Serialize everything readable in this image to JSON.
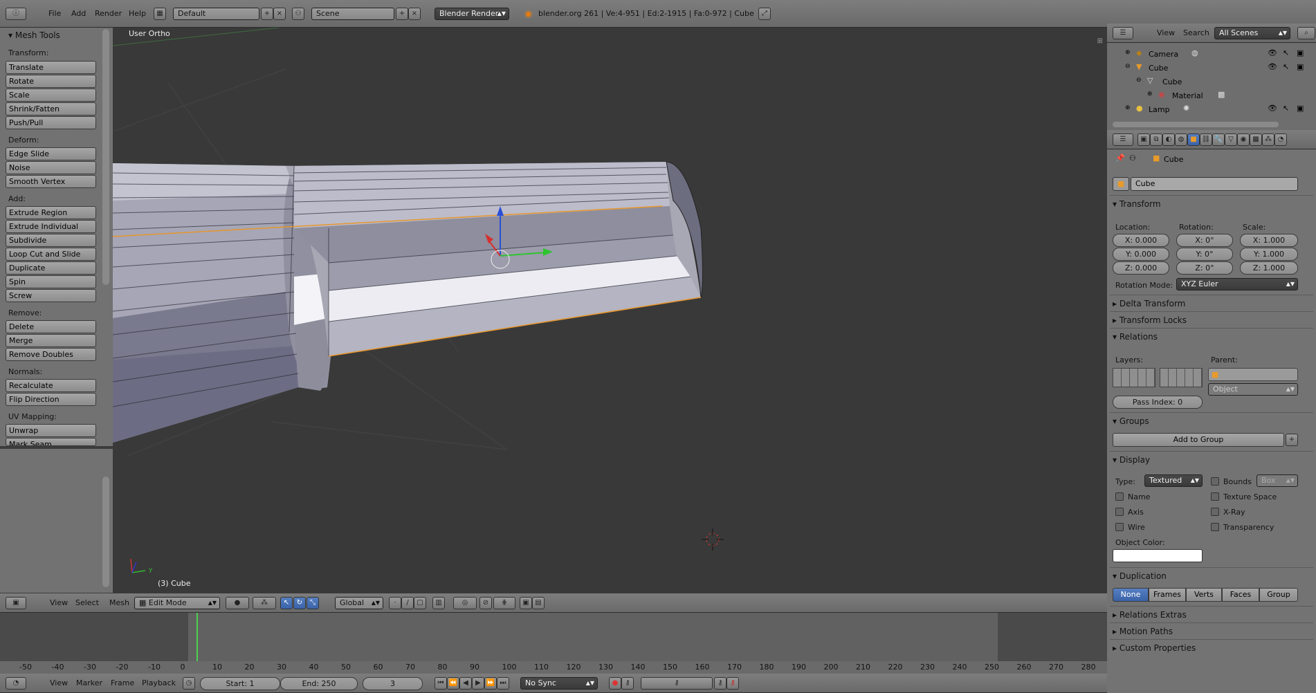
{
  "top_header": {
    "menus": [
      "File",
      "Add",
      "Render",
      "Help"
    ],
    "layout": "Default",
    "scene": "Scene",
    "engine": "Blender Render",
    "stats": "blender.org 261 | Ve:4-951 | Ed:2-1915 | Fa:0-972 | Cube"
  },
  "tool_shelf": {
    "title": "Mesh Tools",
    "groups": [
      {
        "label": "Transform:",
        "buttons": [
          "Translate",
          "Rotate",
          "Scale",
          "Shrink/Fatten",
          "Push/Pull"
        ]
      },
      {
        "label": "Deform:",
        "buttons": [
          "Edge Slide",
          "Noise",
          "Smooth Vertex"
        ]
      },
      {
        "label": "Add:",
        "buttons": [
          "Extrude Region",
          "Extrude Individual",
          "Subdivide",
          "Loop Cut and Slide",
          "Duplicate",
          "Spin",
          "Screw"
        ]
      },
      {
        "label": "Remove:",
        "buttons": [
          "Delete",
          "Merge",
          "Remove Doubles"
        ]
      },
      {
        "label": "Normals:",
        "buttons": [
          "Recalculate",
          "Flip Direction"
        ]
      },
      {
        "label": "UV Mapping:",
        "buttons": [
          "Unwrap",
          "Mark Seam"
        ]
      }
    ]
  },
  "viewport": {
    "view_label": "User Ortho",
    "object_label": "(3) Cube",
    "axis_y": "y"
  },
  "viewport_header": {
    "menus": [
      "View",
      "Select",
      "Mesh"
    ],
    "mode": "Edit Mode",
    "orientation": "Global"
  },
  "outliner": {
    "menus": [
      "View",
      "Search"
    ],
    "scenes": "All Scenes",
    "items": [
      {
        "name": "Camera"
      },
      {
        "name": "Cube"
      },
      {
        "name": "Cube"
      },
      {
        "name": "Material"
      },
      {
        "name": "Lamp"
      }
    ]
  },
  "properties": {
    "context": "Cube",
    "object_name": "Cube",
    "transform": {
      "header": "Transform",
      "location_label": "Location:",
      "rotation_label": "Rotation:",
      "scale_label": "Scale:",
      "location": [
        "X: 0.000",
        "Y: 0.000",
        "Z: 0.000"
      ],
      "rotation": [
        "X: 0°",
        "Y: 0°",
        "Z: 0°"
      ],
      "scale": [
        "X: 1.000",
        "Y: 1.000",
        "Z: 1.000"
      ],
      "rotation_mode_label": "Rotation Mode:",
      "rotation_mode": "XYZ Euler"
    },
    "delta_transform": "Delta Transform",
    "transform_locks": "Transform Locks",
    "relations": {
      "header": "Relations",
      "layers_label": "Layers:",
      "parent_label": "Parent:",
      "parent_type": "Object",
      "pass_index": "Pass Index: 0"
    },
    "groups": {
      "header": "Groups",
      "add_button": "Add to Group"
    },
    "display": {
      "header": "Display",
      "type_label": "Type:",
      "type": "Textured",
      "bounds": "Bounds",
      "bounds_type": "Box",
      "name": "Name",
      "texture_space": "Texture Space",
      "axis": "Axis",
      "xray": "X-Ray",
      "wire": "Wire",
      "transparency": "Transparency",
      "object_color_label": "Object Color:"
    },
    "duplication": {
      "header": "Duplication",
      "options": [
        "None",
        "Frames",
        "Verts",
        "Faces",
        "Group"
      ]
    },
    "relations_extras": "Relations Extras",
    "motion_paths": "Motion Paths",
    "custom_properties": "Custom Properties"
  },
  "timeline": {
    "ticks": [
      "-50",
      "-40",
      "-30",
      "-20",
      "-10",
      "0",
      "10",
      "20",
      "30",
      "40",
      "50",
      "60",
      "70",
      "80",
      "90",
      "100",
      "110",
      "120",
      "130",
      "140",
      "150",
      "160",
      "170",
      "180",
      "190",
      "200",
      "210",
      "220",
      "230",
      "240",
      "250",
      "260",
      "270",
      "280"
    ],
    "current_frame": 3
  },
  "timeline_header": {
    "menus": [
      "View",
      "Marker",
      "Frame",
      "Playback"
    ],
    "start": "Start: 1",
    "end": "End: 250",
    "current": "3",
    "sync": "No Sync"
  },
  "colors": {
    "selection": "#e8962a",
    "accent_blue": "#5680c2"
  }
}
